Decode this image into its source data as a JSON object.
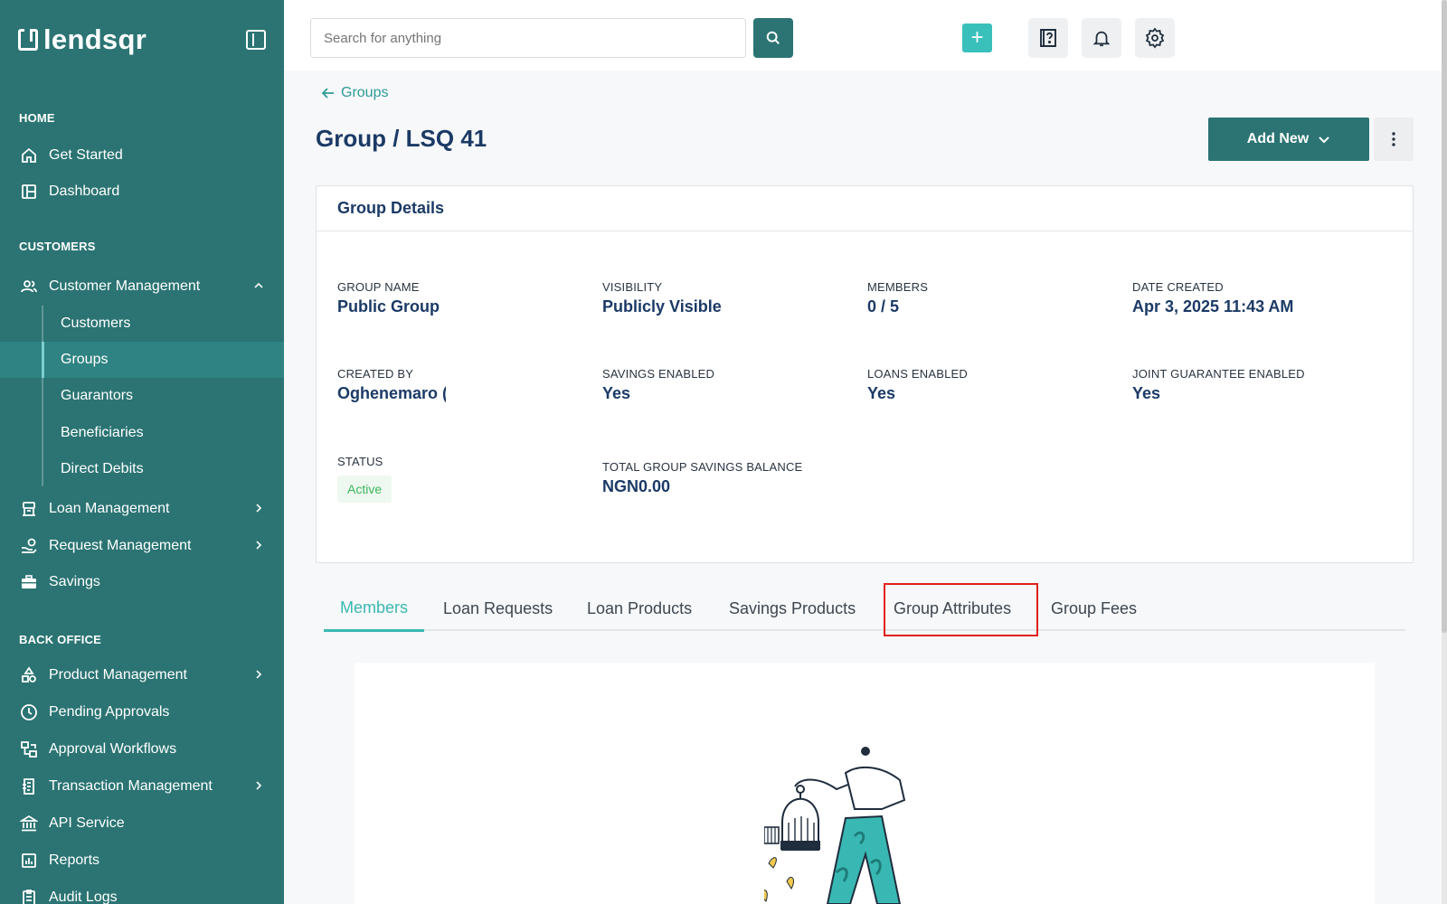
{
  "brand": {
    "name": "lendsqr"
  },
  "sidebar": {
    "sections": {
      "home": "HOME",
      "customers": "CUSTOMERS",
      "back_office": "BACK OFFICE"
    },
    "items": {
      "get_started": "Get Started",
      "dashboard": "Dashboard",
      "customer_management": "Customer Management",
      "customers": "Customers",
      "groups": "Groups",
      "guarantors": "Guarantors",
      "beneficiaries": "Beneficiaries",
      "direct_debits": "Direct Debits",
      "loan_management": "Loan Management",
      "request_management": "Request Management",
      "savings": "Savings",
      "product_management": "Product Management",
      "pending_approvals": "Pending Approvals",
      "approval_workflows": "Approval Workflows",
      "transaction_management": "Transaction Management",
      "api_service": "API Service",
      "reports": "Reports",
      "audit_logs": "Audit Logs"
    },
    "active_item": "Groups"
  },
  "topbar": {
    "search_placeholder": "Search for anything",
    "plus_label": "+"
  },
  "breadcrumb": {
    "back_label": "Groups"
  },
  "page": {
    "title": "Group / LSQ 41",
    "add_new_label": "Add New"
  },
  "details": {
    "heading": "Group Details",
    "group_name": {
      "label": "GROUP NAME",
      "value": "Public Group"
    },
    "visibility": {
      "label": "VISIBILITY",
      "value": "Publicly Visible"
    },
    "members": {
      "label": "MEMBERS",
      "value": "0 / 5"
    },
    "date_created": {
      "label": "DATE CREATED",
      "value": "Apr 3, 2025 11:43 AM"
    },
    "created_by": {
      "label": "CREATED BY",
      "value": "Oghenemaro ("
    },
    "savings_enabled": {
      "label": "SAVINGS ENABLED",
      "value": "Yes"
    },
    "loans_enabled": {
      "label": "LOANS ENABLED",
      "value": "Yes"
    },
    "joint_guarantee": {
      "label": "JOINT GUARANTEE ENABLED",
      "value": "Yes"
    },
    "status": {
      "label": "STATUS",
      "value": "Active"
    },
    "total_savings": {
      "label": "TOTAL GROUP SAVINGS BALANCE",
      "value": "NGN0.00"
    }
  },
  "tabs": [
    {
      "label": "Members",
      "active": true
    },
    {
      "label": "Loan Requests",
      "active": false
    },
    {
      "label": "Loan Products",
      "active": false
    },
    {
      "label": "Savings Products",
      "active": false
    },
    {
      "label": "Group Attributes",
      "active": false
    },
    {
      "label": "Group Fees",
      "active": false
    }
  ],
  "colors": {
    "sidebar": "#2b7473",
    "accent": "#39b8b3",
    "title": "#1b3a66",
    "highlight_box": "#e0201c",
    "status_active": "#3bb45b"
  }
}
